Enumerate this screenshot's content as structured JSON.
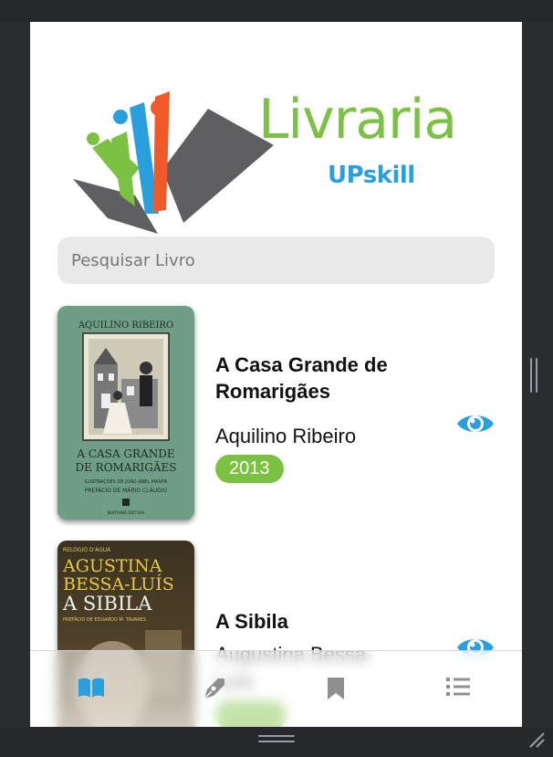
{
  "brand": {
    "name": "Livraria",
    "subtitle": "UPskill",
    "colors": {
      "green": "#7cc242",
      "blue": "#2a9fdd",
      "orange": "#f05a28",
      "gray": "#5f5f61"
    }
  },
  "search": {
    "placeholder": "Pesquisar Livro",
    "value": ""
  },
  "books": [
    {
      "title": "A Casa Grande de Romarigães",
      "author": "Aquilino Ribeiro",
      "year": "2013",
      "cover": {
        "author_text": "AQUILINO RIBEIRO",
        "title_line1": "A CASA GRANDE",
        "title_line2": "DE ROMARIGÃES",
        "illustration_credit": "ILUSTRAÇÕES DE JOÃO ABEL MANTA",
        "preface": "PREFÁCIO DE MÁRIO CLÁUDIO",
        "publisher": "BERTRAND EDITORA"
      }
    },
    {
      "title": "A Sibila",
      "author": "Augustina Bessa-Luís",
      "year": "",
      "cover": {
        "series": "RELOGIO D'AGUA",
        "author_line1": "AGUSTINA",
        "author_line2": "BESSA-LUÍS",
        "title": "A SIBILA",
        "preface": "PREFÁCIO DE EDUARDO M. TAVARES"
      }
    }
  ],
  "tabs": [
    {
      "id": "books",
      "icon": "open-book-icon",
      "active": true
    },
    {
      "id": "authors",
      "icon": "pen-nib-icon",
      "active": false
    },
    {
      "id": "saved",
      "icon": "bookmark-icon",
      "active": false
    },
    {
      "id": "list",
      "icon": "list-icon",
      "active": false
    }
  ],
  "accent": "#2a9fdd"
}
